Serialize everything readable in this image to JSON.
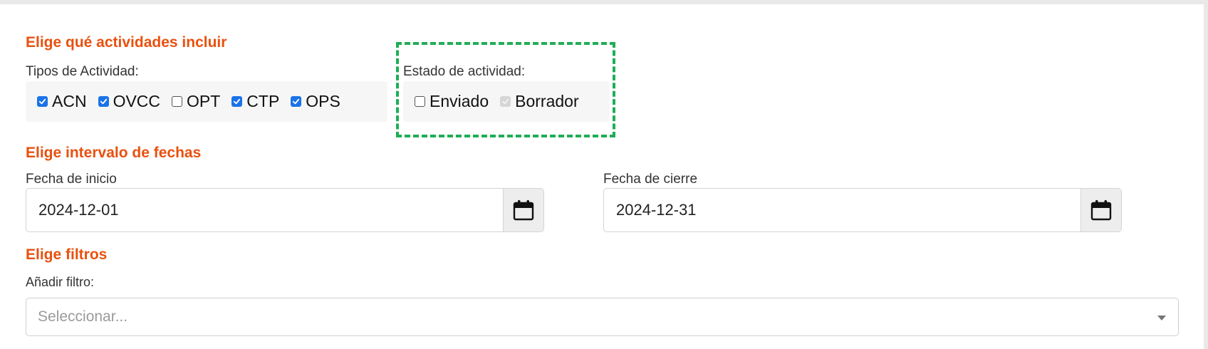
{
  "activities_section": {
    "title": "Elige qué actividades incluir",
    "types_label": "Tipos de Actividad:",
    "types": [
      {
        "label": "ACN",
        "state": "checked"
      },
      {
        "label": "OVCC",
        "state": "checked"
      },
      {
        "label": "OPT",
        "state": "unchecked"
      },
      {
        "label": "CTP",
        "state": "checked"
      },
      {
        "label": "OPS",
        "state": "checked"
      }
    ],
    "status_label": "Estado de actividad:",
    "statuses": [
      {
        "label": "Enviado",
        "state": "unchecked"
      },
      {
        "label": "Borrador",
        "state": "checked-disabled"
      }
    ]
  },
  "date_section": {
    "title": "Elige intervalo de fechas",
    "start_label": "Fecha de inicio",
    "start_value": "2024-12-01",
    "end_label": "Fecha de cierre",
    "end_value": "2024-12-31"
  },
  "filters_section": {
    "title": "Elige filtros",
    "add_filter_label": "Añadir filtro:",
    "select_placeholder": "Seleccionar..."
  },
  "colors": {
    "section_title": "#e8510f",
    "checkbox_checked": "#1a73e8",
    "highlight_border": "#1fae55"
  },
  "icons": {
    "calendar": "calendar-icon",
    "dropdown": "chevron-down-icon",
    "check": "check-icon"
  }
}
